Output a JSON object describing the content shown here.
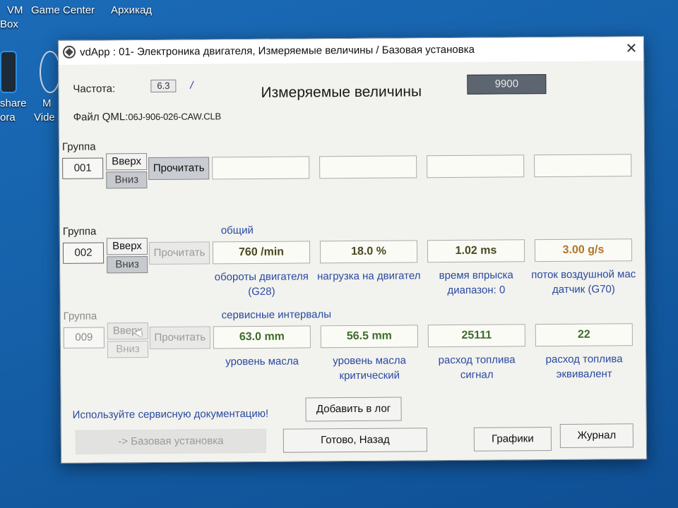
{
  "desktop": {
    "icons": [
      {
        "label": "VM"
      },
      {
        "label": "Box"
      },
      {
        "label": "Game Center"
      },
      {
        "label": "Архикад"
      },
      {
        "label": "share"
      },
      {
        "label": "ora"
      },
      {
        "label": "M"
      },
      {
        "label": "Vide"
      }
    ]
  },
  "window": {
    "title": "vdApp : 01- Электроника двигателя,  Измеряемые величины / Базовая установка",
    "close_glyph": "✕"
  },
  "header": {
    "freq_label": "Частота:",
    "freq_value": "6.3",
    "freq_unit": "/",
    "title": "Измеряемые величины",
    "counter": "9900",
    "file_label": "Файл QML:",
    "file_value": "06J-906-026-CAW.CLB"
  },
  "groups": [
    {
      "label": "Группа",
      "number": "001",
      "up_label": "Вверх",
      "down_label": "Вниз",
      "read_label": "Прочитать",
      "section": "",
      "values": [
        "",
        "",
        "",
        ""
      ],
      "captions": [
        "",
        "",
        "",
        ""
      ]
    },
    {
      "label": "Группа",
      "number": "002",
      "up_label": "Вверх",
      "down_label": "Вниз",
      "read_label": "Прочитать",
      "section": "общий",
      "values": [
        "760 /min",
        "18.0 %",
        "1.02 ms",
        "3.00 g/s"
      ],
      "captions": [
        [
          "обороты двигателя",
          "(G28)"
        ],
        [
          "нагрузка на двигател",
          ""
        ],
        [
          "время впрыска",
          "диапазон: 0"
        ],
        [
          "поток воздушной мас",
          "датчик (G70)"
        ]
      ]
    },
    {
      "label": "Группа",
      "number": "009",
      "up_label": "Вверх",
      "down_label": "Вниз",
      "read_label": "Прочитать",
      "section": "сервисные интервалы",
      "values": [
        "63.0 mm",
        "56.5 mm",
        "25111",
        "22"
      ],
      "captions": [
        [
          "уровень масла",
          ""
        ],
        [
          "уровень масла",
          "критический"
        ],
        [
          "расход топлива",
          "сигнал"
        ],
        [
          "расход топлива",
          "эквивалент"
        ]
      ]
    }
  ],
  "footer": {
    "note": "Используйте сервисную документацию!",
    "add_log": "Добавить в лог",
    "basic_setting": "-> Базовая установка",
    "done_back": "Готово, Назад",
    "graphs": "Графики",
    "journal": "Журнал"
  },
  "colors": {
    "desktop_bg": "#1560a8",
    "window_bg": "#f2f2ee",
    "caption_blue": "#2a4aa0",
    "value_green": "#3d6d2a",
    "value_orange": "#b0752a",
    "counter_bg": "#5d6670"
  }
}
